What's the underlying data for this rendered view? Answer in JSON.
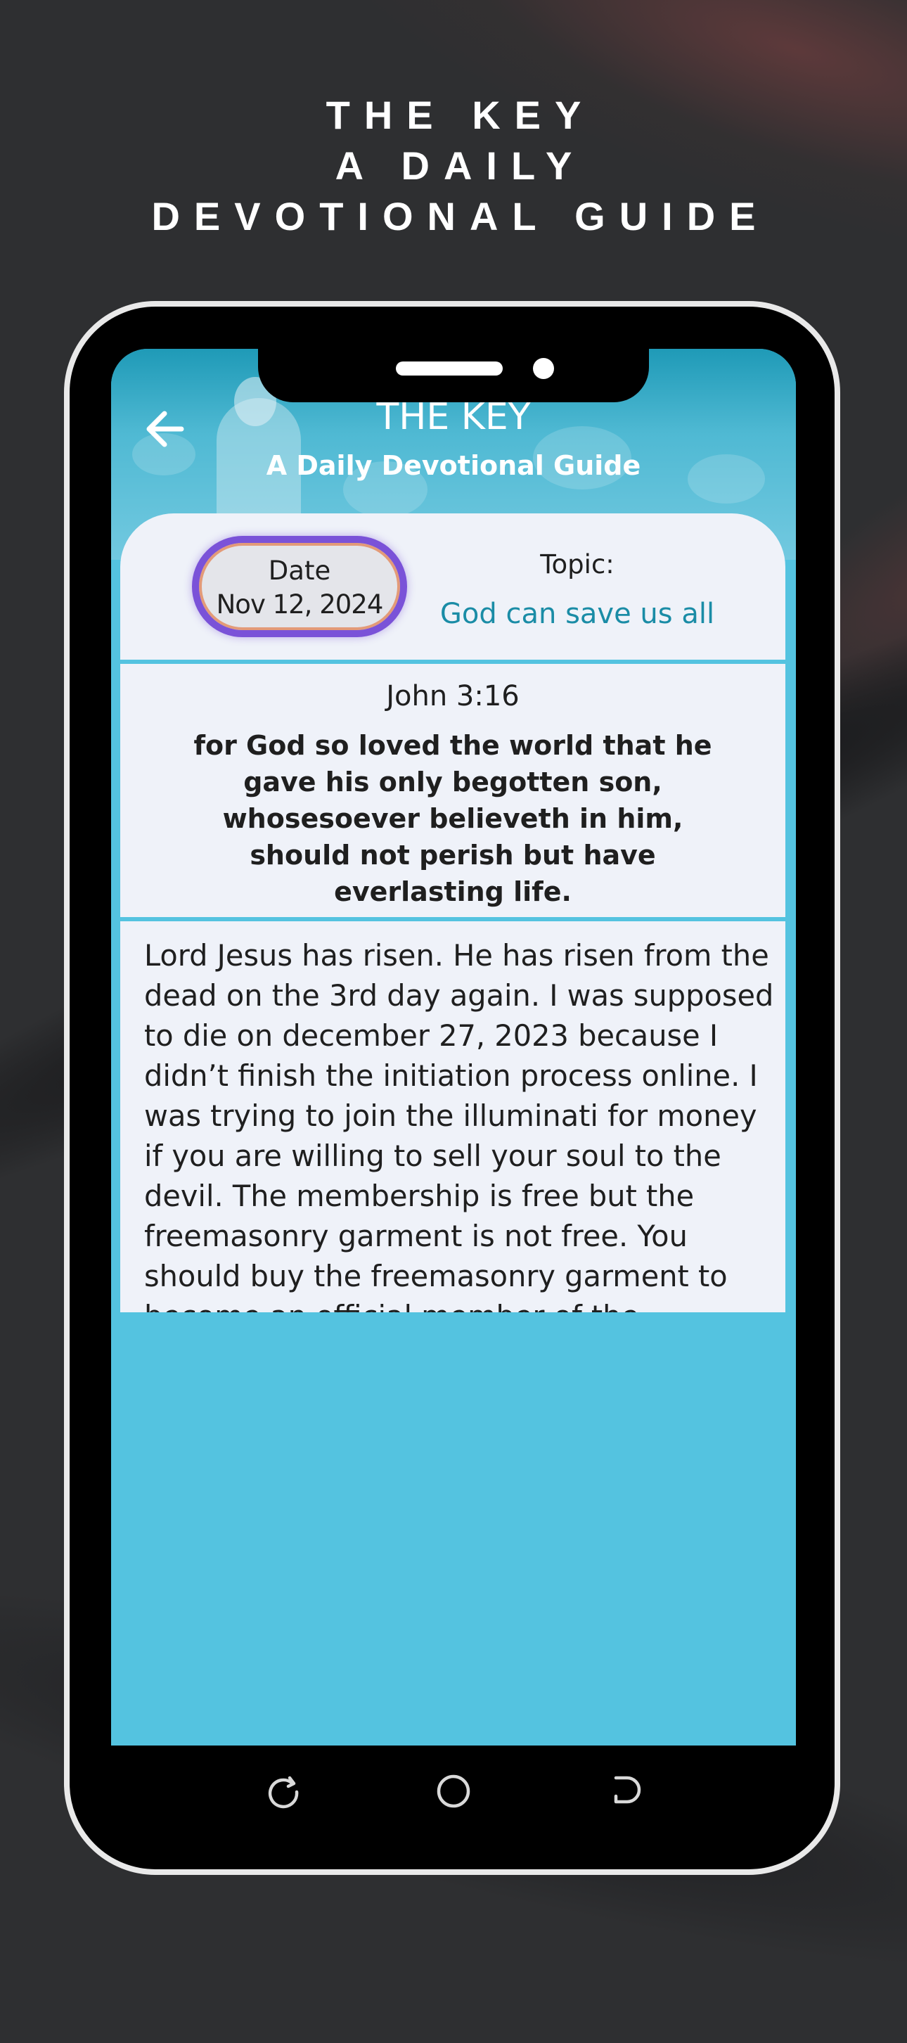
{
  "headline": {
    "line1": "THE KEY",
    "line2": "A DAILY",
    "line3": "DEVOTIONAL GUIDE"
  },
  "app_header": {
    "title": "THE KEY",
    "subtitle": "A Daily Devotional Guide",
    "back_icon": "arrow-left-icon"
  },
  "date_card": {
    "date_label": "Date",
    "date_value": "Nov 12, 2024",
    "topic_label": "Topic:",
    "topic_value": "God can save us all"
  },
  "verse": {
    "reference": "John 3:16",
    "text": "for God so loved the world that he gave his only begotten son, whosesoever believeth in him, should not perish but have everlasting life."
  },
  "devotional": {
    "body": "Lord Jesus has risen. He has risen from the dead on the 3rd day again. I was supposed to die on december 27, 2023 because I didn’t finish the initiation process online. I was trying to join the illuminati for money if you are willing to sell your soul to the devil. The membership is free but the freemasonry garment is not free. You should buy the freemasonry garment to become an official member of the illuminati. I knew celebrities dark secrets and I know how they were initiated. I don’t have a job and I don’t have money. But I have money from the election day. That was around election day and we’ve just voted out of town. My money is only over 4,000 pesos. I tried to send my"
  },
  "system_nav": {
    "recents_icon": "recent-apps-icon",
    "home_icon": "home-circle-icon",
    "back_icon": "back-nav-icon"
  },
  "colors": {
    "background": "#2e2f31",
    "accent": "#1a8ca6",
    "card": "#eff2f9",
    "screen_bottom": "#54c3e0",
    "date_pill_border": "#7a52d8"
  }
}
